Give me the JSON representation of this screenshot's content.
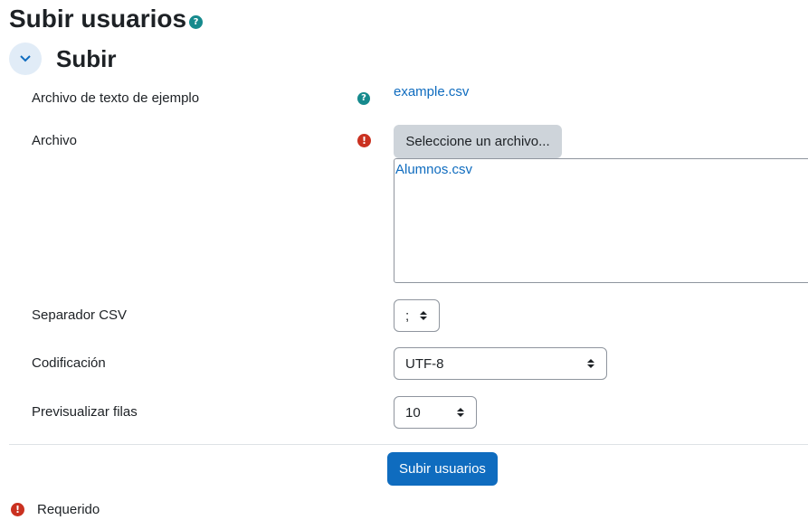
{
  "page": {
    "title": "Subir usuarios"
  },
  "section": {
    "title": "Subir"
  },
  "fields": {
    "example_label": "Archivo de texto de ejemplo",
    "example_link": "example.csv",
    "file_label": "Archivo",
    "file_button": "Seleccione un archivo...",
    "selected_file": "Alumnos.csv",
    "separator_label": "Separador CSV",
    "separator_value": ";",
    "encoding_label": "Codificación",
    "encoding_value": "UTF-8",
    "preview_label": "Previsualizar filas",
    "preview_value": "10"
  },
  "actions": {
    "submit_label": "Subir usuarios"
  },
  "footer": {
    "required_label": "Requerido"
  },
  "icons": {
    "help_glyph": "?",
    "required_glyph": "!"
  },
  "colors": {
    "accent": "#0f6cbf",
    "required": "#ca3120",
    "help": "#168a8d"
  }
}
